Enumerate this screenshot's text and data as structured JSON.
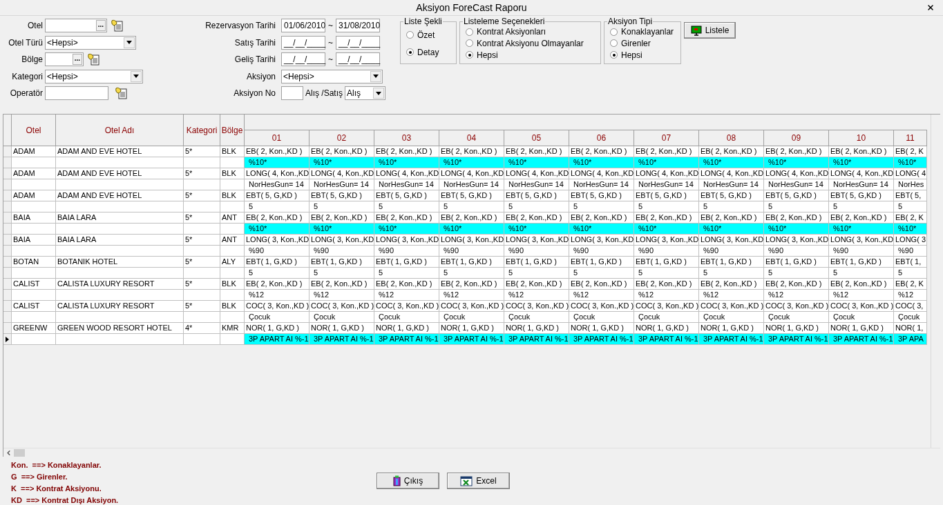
{
  "window": {
    "title": "Aksiyon ForeCast Raporu"
  },
  "filters_left": [
    {
      "label": "Otel",
      "kind": "lookup",
      "button": "..."
    },
    {
      "label": "Otel Türü",
      "kind": "dropdown",
      "value": "<Hepsi>"
    },
    {
      "label": "Bölge",
      "kind": "lookup",
      "button": "..."
    },
    {
      "label": "Kategori",
      "kind": "dropdown",
      "value": "<Hepsi>"
    },
    {
      "label": "Operatör",
      "kind": "picker"
    }
  ],
  "filters_mid": [
    {
      "label": "Rezervasyon Tarihi",
      "kind": "date_range",
      "from": "01/06/2010",
      "separator": "~",
      "to": "31/08/2010"
    },
    {
      "label": "Satış Tarihi",
      "kind": "date_range",
      "from": "__/__/____",
      "separator": "~",
      "to": "__/__/____"
    },
    {
      "label": "Geliş Tarihi",
      "kind": "date_range",
      "from": "__/__/____",
      "separator": "~",
      "to": "__/__/____"
    },
    {
      "label": "Aksiyon",
      "kind": "dropdown",
      "value": "<Hepsi>"
    },
    {
      "label": "Aksiyon No",
      "kind": "number_with_type",
      "type_label": "Alış /Satış",
      "type_value": "Alış"
    }
  ],
  "radio_groups": [
    {
      "title": "Liste Şekli",
      "options": [
        {
          "label": "Özet",
          "selected": false
        },
        {
          "label": "Detay",
          "selected": true
        }
      ]
    },
    {
      "title": "Listeleme Seçenekleri",
      "options": [
        {
          "label": "Kontrat Aksiyonları",
          "selected": false
        },
        {
          "label": "Kontrat Aksiyonu Olmayanlar",
          "selected": false
        },
        {
          "label": "Hepsi",
          "selected": true
        }
      ]
    },
    {
      "title": "Aksiyon Tipi",
      "options": [
        {
          "label": "Konaklayanlar",
          "selected": false
        },
        {
          "label": "Girenler",
          "selected": false
        },
        {
          "label": "Hepsi",
          "selected": true
        }
      ]
    }
  ],
  "list_button": "Listele",
  "grid": {
    "columns": [
      "Otel",
      "Otel Adı",
      "Kategori",
      "Bölge"
    ],
    "days": [
      "01",
      "02",
      "03",
      "04",
      "05",
      "06",
      "07",
      "08",
      "09",
      "10",
      "11"
    ],
    "rows": [
      {
        "otel": "ADAM",
        "otel_adi": "ADAM AND EVE HOTEL",
        "kategori": "5*",
        "bolge": "BLK",
        "highlighted": true,
        "current": false,
        "line1": [
          "EB( 2, Kon.,KD )",
          "EB( 2, Kon.,KD )",
          "EB( 2, Kon.,KD )",
          "EB( 2, Kon.,KD )",
          "EB( 2, Kon.,KD )",
          "EB( 2, Kon.,KD )",
          "EB( 2, Kon.,KD )",
          "EB( 2, Kon.,KD )",
          "EB( 2, Kon.,KD )",
          "EB( 2, Kon.,KD )",
          "EB( 2, K"
        ],
        "line2": [
          "%10*",
          "%10*",
          "%10*",
          "%10*",
          "%10*",
          "%10*",
          "%10*",
          "%10*",
          "%10*",
          "%10*",
          "%10*"
        ]
      },
      {
        "otel": "ADAM",
        "otel_adi": "ADAM AND EVE HOTEL",
        "kategori": "5*",
        "bolge": "BLK",
        "highlighted": false,
        "current": false,
        "line1": [
          "LONG( 4, Kon.,KD",
          "LONG( 4, Kon.,KD",
          "LONG( 4, Kon.,KD",
          "LONG( 4, Kon.,KD",
          "LONG( 4, Kon.,KD",
          "LONG( 4, Kon.,KD",
          "LONG( 4, Kon.,KD",
          "LONG( 4, Kon.,KD",
          "LONG( 4, Kon.,KD",
          "LONG( 4, Kon.,KD",
          "LONG( 4"
        ],
        "line2": [
          "NorHesGun= 14",
          "NorHesGun= 14",
          "NorHesGun= 14",
          "NorHesGun= 14",
          "NorHesGun= 14",
          "NorHesGun= 14",
          "NorHesGun= 14",
          "NorHesGun= 14",
          "NorHesGun= 14",
          "NorHesGun= 14",
          "NorHes"
        ]
      },
      {
        "otel": "ADAM",
        "otel_adi": "ADAM AND EVE HOTEL",
        "kategori": "5*",
        "bolge": "BLK",
        "highlighted": false,
        "current": false,
        "line1": [
          "EBT( 5, G,KD )",
          "EBT( 5, G,KD )",
          "EBT( 5, G,KD )",
          "EBT( 5, G,KD )",
          "EBT( 5, G,KD )",
          "EBT( 5, G,KD )",
          "EBT( 5, G,KD )",
          "EBT( 5, G,KD )",
          "EBT( 5, G,KD )",
          "EBT( 5, G,KD )",
          "EBT( 5,"
        ],
        "line2": [
          "5",
          "5",
          "5",
          "5",
          "5",
          "5",
          "5",
          "5",
          "5",
          "5",
          "5"
        ]
      },
      {
        "otel": "BAIA",
        "otel_adi": "BAIA LARA",
        "kategori": "5*",
        "bolge": "ANT",
        "highlighted": true,
        "current": false,
        "line1": [
          "EB( 2, Kon.,KD )",
          "EB( 2, Kon.,KD )",
          "EB( 2, Kon.,KD )",
          "EB( 2, Kon.,KD )",
          "EB( 2, Kon.,KD )",
          "EB( 2, Kon.,KD )",
          "EB( 2, Kon.,KD )",
          "EB( 2, Kon.,KD )",
          "EB( 2, Kon.,KD )",
          "EB( 2, Kon.,KD )",
          "EB( 2, K"
        ],
        "line2": [
          "%10*",
          "%10*",
          "%10*",
          "%10*",
          "%10*",
          "%10*",
          "%10*",
          "%10*",
          "%10*",
          "%10*",
          "%10*"
        ]
      },
      {
        "otel": "BAIA",
        "otel_adi": "BAIA LARA",
        "kategori": "5*",
        "bolge": "ANT",
        "highlighted": false,
        "current": false,
        "line1": [
          "LONG( 3, Kon.,KD",
          "LONG( 3, Kon.,KD",
          "LONG( 3, Kon.,KD",
          "LONG( 3, Kon.,KD",
          "LONG( 3, Kon.,KD",
          "LONG( 3, Kon.,KD",
          "LONG( 3, Kon.,KD",
          "LONG( 3, Kon.,KD",
          "LONG( 3, Kon.,KD",
          "LONG( 3, Kon.,KD",
          "LONG( 3"
        ],
        "line2": [
          "%90",
          "%90",
          "%90",
          "%90",
          "%90",
          "%90",
          "%90",
          "%90",
          "%90",
          "%90",
          "%90"
        ]
      },
      {
        "otel": "BOTAN",
        "otel_adi": "BOTANIK HOTEL",
        "kategori": "5*",
        "bolge": "ALY",
        "highlighted": false,
        "current": false,
        "line1": [
          "EBT( 1, G,KD )",
          "EBT( 1, G,KD )",
          "EBT( 1, G,KD )",
          "EBT( 1, G,KD )",
          "EBT( 1, G,KD )",
          "EBT( 1, G,KD )",
          "EBT( 1, G,KD )",
          "EBT( 1, G,KD )",
          "EBT( 1, G,KD )",
          "EBT( 1, G,KD )",
          "EBT( 1,"
        ],
        "line2": [
          "5",
          "5",
          "5",
          "5",
          "5",
          "5",
          "5",
          "5",
          "5",
          "5",
          "5"
        ]
      },
      {
        "otel": "CALIST",
        "otel_adi": "CALISTA LUXURY RESORT",
        "kategori": "5*",
        "bolge": "BLK",
        "highlighted": false,
        "current": false,
        "line1": [
          "EB( 2, Kon.,KD )",
          "EB( 2, Kon.,KD )",
          "EB( 2, Kon.,KD )",
          "EB( 2, Kon.,KD )",
          "EB( 2, Kon.,KD )",
          "EB( 2, Kon.,KD )",
          "EB( 2, Kon.,KD )",
          "EB( 2, Kon.,KD )",
          "EB( 2, Kon.,KD )",
          "EB( 2, Kon.,KD )",
          "EB( 2, K"
        ],
        "line2": [
          "%12",
          "%12",
          "%12",
          "%12",
          "%12",
          "%12",
          "%12",
          "%12",
          "%12",
          "%12",
          "%12"
        ]
      },
      {
        "otel": "CALIST",
        "otel_adi": "CALISTA LUXURY RESORT",
        "kategori": "5*",
        "bolge": "BLK",
        "highlighted": false,
        "current": false,
        "line1": [
          "COC( 3, Kon.,KD )",
          "COC( 3, Kon.,KD )",
          "COC( 3, Kon.,KD )",
          "COC( 3, Kon.,KD )",
          "COC( 3, Kon.,KD )",
          "COC( 3, Kon.,KD )",
          "COC( 3, Kon.,KD )",
          "COC( 3, Kon.,KD )",
          "COC( 3, Kon.,KD )",
          "COC( 3, Kon.,KD )",
          "COC( 3,"
        ],
        "line2": [
          "Çocuk",
          "Çocuk",
          "Çocuk",
          "Çocuk",
          "Çocuk",
          "Çocuk",
          "Çocuk",
          "Çocuk",
          "Çocuk",
          "Çocuk",
          "Çocuk"
        ]
      },
      {
        "otel": "GREENW",
        "otel_adi": "GREEN WOOD RESORT HOTEL",
        "kategori": "4*",
        "bolge": "KMR",
        "highlighted": true,
        "current": true,
        "line1": [
          "NOR( 1, G,KD )",
          "NOR( 1, G,KD )",
          "NOR( 1, G,KD )",
          "NOR( 1, G,KD )",
          "NOR( 1, G,KD )",
          "NOR( 1, G,KD )",
          "NOR( 1, G,KD )",
          "NOR( 1, G,KD )",
          "NOR( 1, G,KD )",
          "NOR( 1, G,KD )",
          "NOR( 1,"
        ],
        "line2": [
          "3P APART AI %-1",
          "3P APART AI %-1",
          "3P APART AI %-1",
          "3P APART AI %-1",
          "3P APART AI %-1",
          "3P APART AI %-1",
          "3P APART AI %-1",
          "3P APART AI %-1",
          "3P APART AI %-1",
          "3P APART AI %-1",
          "3P APA"
        ]
      }
    ]
  },
  "legend": [
    "Kon.  ==> Konaklayanlar.",
    "G  ==> Girenler.",
    "K  ==> Kontrat Aksiyonu.",
    "KD  ==> Kontrat Dışı Aksiyon."
  ],
  "buttons": [
    "Çıkış",
    "Excel"
  ]
}
